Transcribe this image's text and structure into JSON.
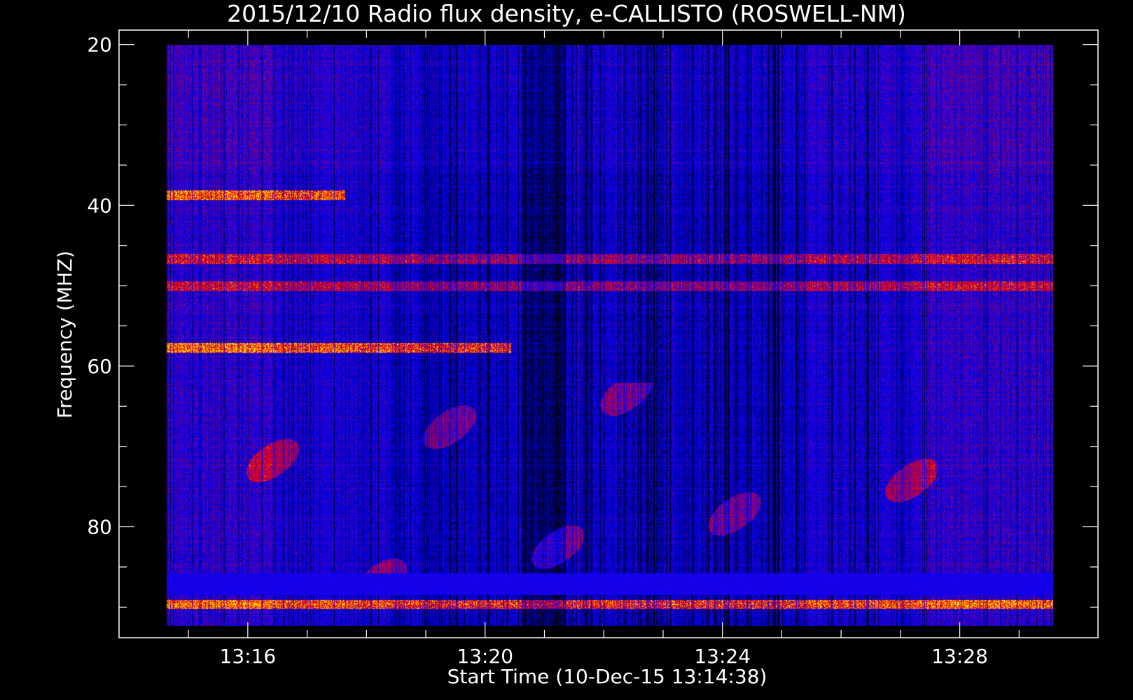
{
  "chart_data": {
    "type": "heatmap",
    "title": "2015/12/10  Radio flux density, e-CALLISTO (ROSWELL-NM)",
    "xlabel": "Start Time (10-Dec-15 13:14:38)",
    "ylabel": "Frequency (MHZ)",
    "x_tick_labels": [
      "13:16",
      "13:20",
      "13:24",
      "13:28"
    ],
    "x_tick_values_min": [
      1.37,
      5.37,
      9.37,
      13.37
    ],
    "y_tick_labels": [
      "20",
      "40",
      "60",
      "80"
    ],
    "y_tick_values": [
      20,
      40,
      60,
      80
    ],
    "xlim_min": [
      -0.8,
      15.7
    ],
    "ylim": [
      93.8,
      18.2
    ],
    "data_xlim_min": [
      0,
      14.95
    ],
    "data_ylim": [
      20,
      92.3
    ],
    "colormap": [
      "#000000",
      "#0000ff",
      "#ff0000",
      "#ffff00"
    ],
    "features": [
      {
        "name": "interference band",
        "freq": 38.7,
        "t_range": [
          0,
          3.0
        ],
        "intensity": "high"
      },
      {
        "name": "interference band",
        "freq": 46.6,
        "t_range": [
          0,
          14.95
        ],
        "intensity": "medium"
      },
      {
        "name": "interference band",
        "freq": 50.0,
        "t_range": [
          0,
          14.95
        ],
        "intensity": "medium"
      },
      {
        "name": "interference band",
        "freq": 57.7,
        "t_range": [
          0,
          5.8
        ],
        "intensity": "high"
      },
      {
        "name": "interference band",
        "freq": 89.6,
        "t_range": [
          0,
          14.95
        ],
        "intensity": "high"
      }
    ]
  }
}
